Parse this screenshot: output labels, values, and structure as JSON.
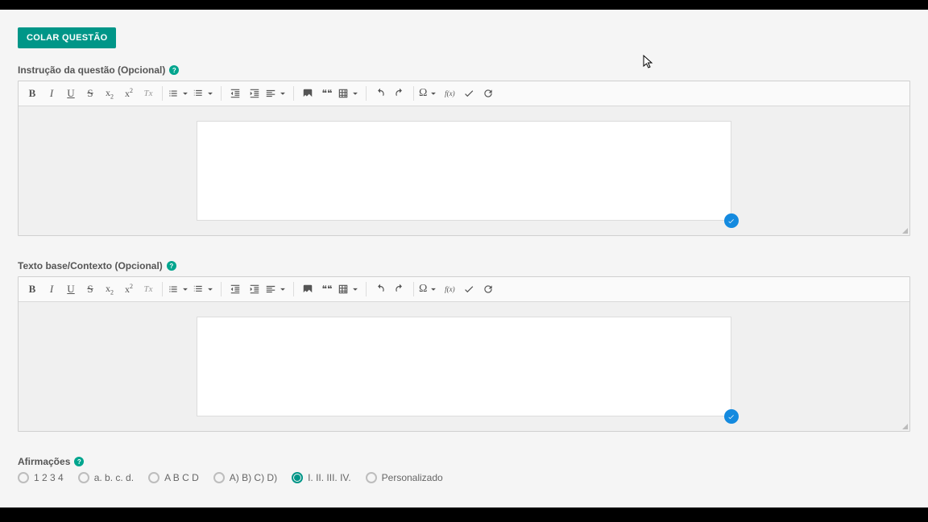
{
  "buttons": {
    "colar_questao": "COLAR QUESTÃO"
  },
  "sections": {
    "instrucao_label": "Instrução da questão (Opcional)",
    "contexto_label": "Texto base/Contexto (Opcional)",
    "afirmacoes_label": "Afirmações"
  },
  "toolbar": {
    "bold": "B",
    "italic": "I",
    "underline": "U",
    "strike": "S",
    "sub": "x",
    "sub_small": "2",
    "sup": "x",
    "sup_small": "2",
    "omega": "Ω",
    "fx": "f(x)",
    "clear_fmt": "Tx",
    "quote": "❝❝"
  },
  "afirmacoes": {
    "options": [
      {
        "label": "1 2 3 4",
        "selected": false
      },
      {
        "label": "a. b. c. d.",
        "selected": false
      },
      {
        "label": "A B C D",
        "selected": false
      },
      {
        "label": "A) B) C) D)",
        "selected": false
      },
      {
        "label": "I. II. III. IV.",
        "selected": true
      },
      {
        "label": "Personalizado",
        "selected": false
      }
    ]
  },
  "icons": {
    "help": "?",
    "check": "✓"
  },
  "colors": {
    "accent": "#009688",
    "badge": "#148adf"
  }
}
